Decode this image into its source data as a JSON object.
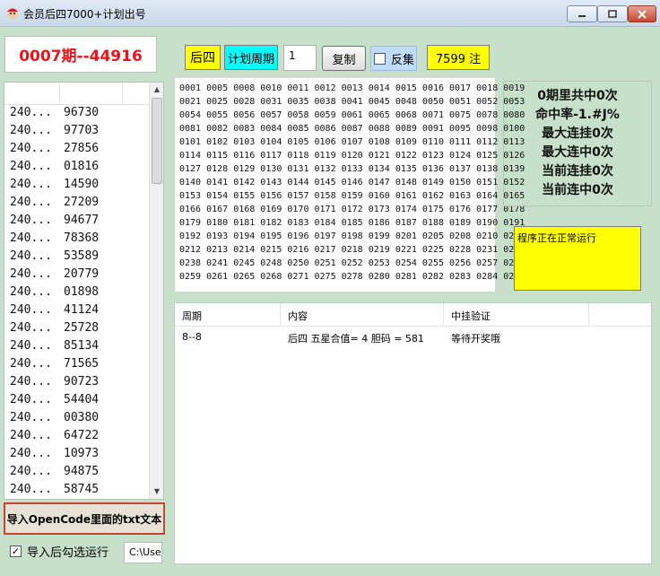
{
  "window": {
    "title": "会员后四7000+计划出号"
  },
  "period_display": "0007期--44916",
  "list": {
    "rows": [
      {
        "period": "240...",
        "number": "96730"
      },
      {
        "period": "240...",
        "number": "97703"
      },
      {
        "period": "240...",
        "number": "27856"
      },
      {
        "period": "240...",
        "number": "01816"
      },
      {
        "period": "240...",
        "number": "14590"
      },
      {
        "period": "240...",
        "number": "27209"
      },
      {
        "period": "240...",
        "number": "94677"
      },
      {
        "period": "240...",
        "number": "78368"
      },
      {
        "period": "240...",
        "number": "53589"
      },
      {
        "period": "240...",
        "number": "20779"
      },
      {
        "period": "240...",
        "number": "01898"
      },
      {
        "period": "240...",
        "number": "41124"
      },
      {
        "period": "240...",
        "number": "25728"
      },
      {
        "period": "240...",
        "number": "85134"
      },
      {
        "period": "240...",
        "number": "71565"
      },
      {
        "period": "240...",
        "number": "90723"
      },
      {
        "period": "240...",
        "number": "54404"
      },
      {
        "period": "240...",
        "number": "00380"
      },
      {
        "period": "240...",
        "number": "64722"
      },
      {
        "period": "240...",
        "number": "10973"
      },
      {
        "period": "240...",
        "number": "94875"
      },
      {
        "period": "240...",
        "number": "58745"
      }
    ]
  },
  "import_button": "导入OpenCode里面的txt文本",
  "auto_run": {
    "label": "导入后勾选运行",
    "checked": true
  },
  "path_field": "C:\\Use",
  "toolbar": {
    "position_tag": "后四",
    "plan_period_tag": "计划周期",
    "cycle_value": "1",
    "copy_button": "复制",
    "reverse_label": "反集",
    "count_badge": "7599 注"
  },
  "number_grid": [
    "0001 0005 0008 0010 0011 0012 0013 0014 0015 0016 0017 0018 0019",
    "0021 0025 0028 0031 0035 0038 0041 0045 0048 0050 0051 0052 0053",
    "0054 0055 0056 0057 0058 0059 0061 0065 0068 0071 0075 0078 0080",
    "0081 0082 0083 0084 0085 0086 0087 0088 0089 0091 0095 0098 0100",
    "0101 0102 0103 0104 0105 0106 0107 0108 0109 0110 0111 0112 0113",
    "0114 0115 0116 0117 0118 0119 0120 0121 0122 0123 0124 0125 0126",
    "0127 0128 0129 0130 0131 0132 0133 0134 0135 0136 0137 0138 0139",
    "0140 0141 0142 0143 0144 0145 0146 0147 0148 0149 0150 0151 0152",
    "0153 0154 0155 0156 0157 0158 0159 0160 0161 0162 0163 0164 0165",
    "0166 0167 0168 0169 0170 0171 0172 0173 0174 0175 0176 0177 0178",
    "0179 0180 0181 0182 0183 0184 0185 0186 0187 0188 0189 0190 0191",
    "0192 0193 0194 0195 0196 0197 0198 0199 0201 0205 0208 0210 0211",
    "0212 0213 0214 0215 0216 0217 0218 0219 0221 0225 0228 0231 0235",
    "0238 0241 0245 0248 0250 0251 0252 0253 0254 0255 0256 0257 0258",
    "0259 0261 0265 0268 0271 0275 0278 0280 0281 0282 0283 0284 0285"
  ],
  "stats": [
    "0期里共中0次",
    "命中率-1.#J%",
    "最大连挂0次",
    "最大连中0次",
    "当前连挂0次",
    "当前连中0次"
  ],
  "status_text": "程序正在正常运行",
  "results": {
    "columns": [
      "周期",
      "内容",
      "中挂验证"
    ],
    "rows": [
      {
        "period": "8--8",
        "content": "后四 五星合值= 4 胆码 = 581",
        "verify": "等待开奖哦"
      }
    ]
  },
  "colors": {
    "background": "#c7e0c9",
    "period_red": "#e8141b",
    "yellow": "#ffff00",
    "cyan": "#00ffff"
  }
}
